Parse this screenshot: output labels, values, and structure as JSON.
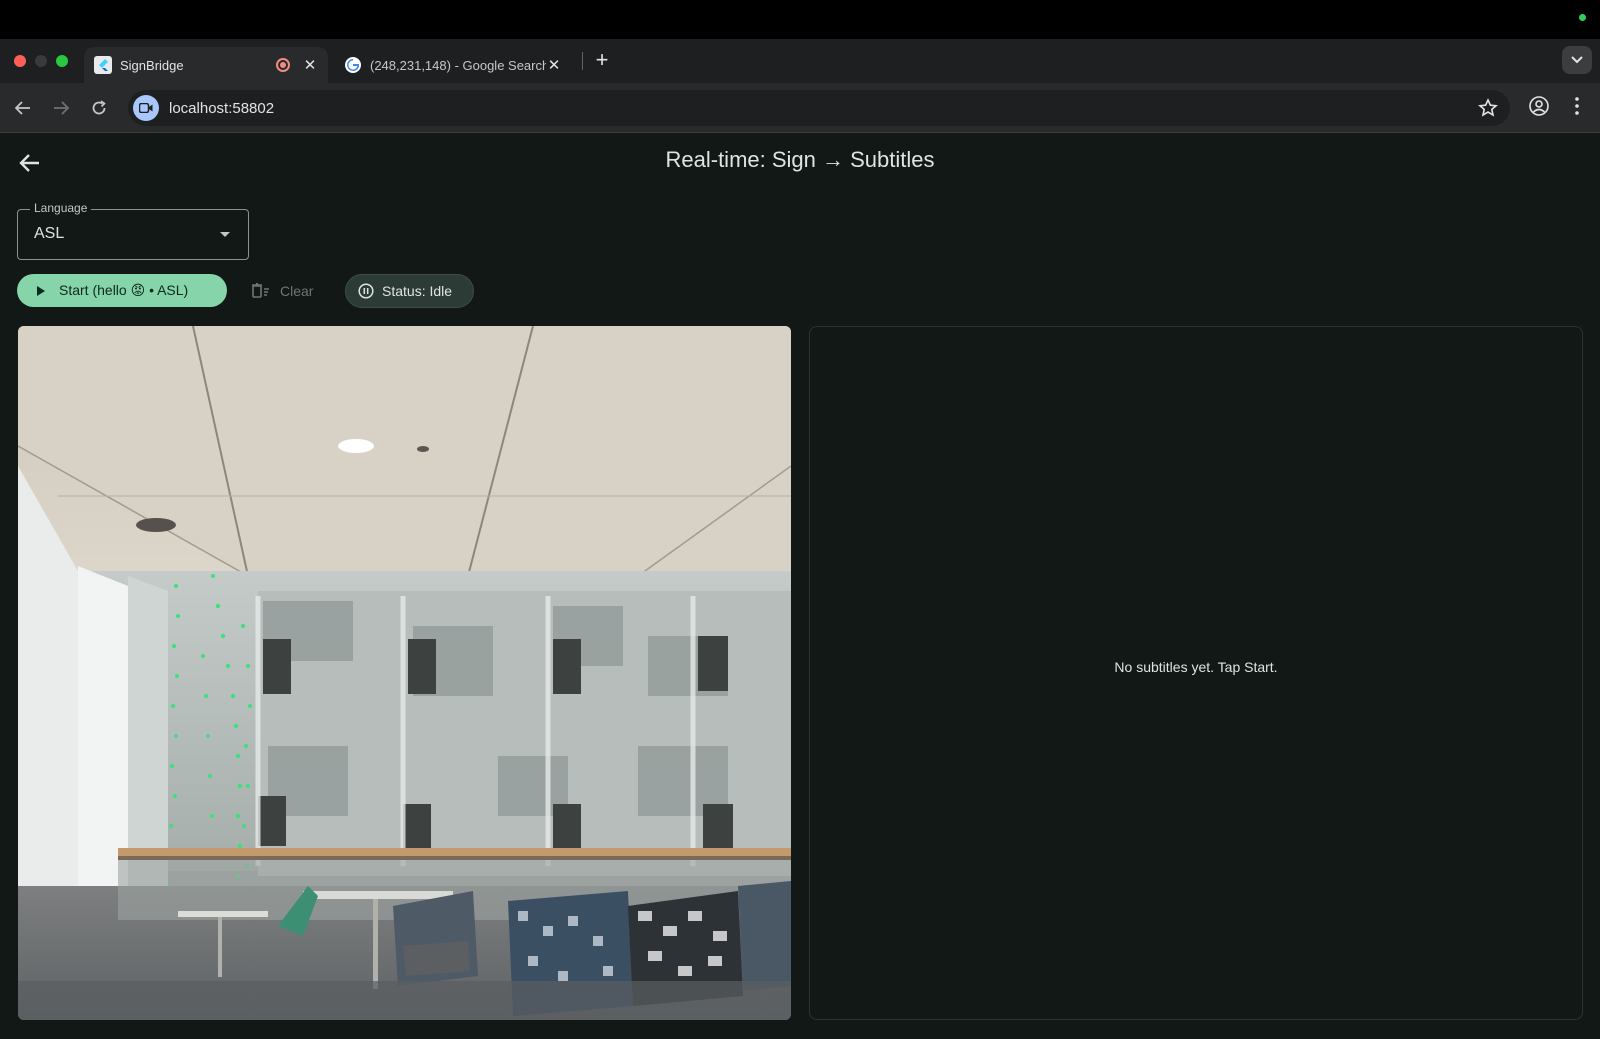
{
  "browser": {
    "tabs": [
      {
        "title": "SignBridge",
        "recording": true,
        "active": true
      },
      {
        "title": "(248,231,148) - Google Search",
        "active": false
      }
    ],
    "url": "localhost:58802"
  },
  "app": {
    "title": "Real-time: Sign → Subtitles",
    "language": {
      "label": "Language",
      "value": "ASL"
    },
    "start_label": "Start (hello 😡 • ASL)",
    "clear_label": "Clear",
    "status_label": "Status: Idle",
    "empty_message": "No subtitles yet. Tap Start."
  },
  "colors": {
    "accent": "#86d4a9",
    "background": "#111816",
    "status_chip": "#2c3b35"
  },
  "icons": [
    "back-arrow-icon",
    "dropdown-caret-icon",
    "play-icon",
    "clear-icon",
    "pause-circle-icon",
    "star-icon",
    "profile-icon",
    "more-vert-icon",
    "reload-icon",
    "forward-icon",
    "camera-site-icon"
  ]
}
